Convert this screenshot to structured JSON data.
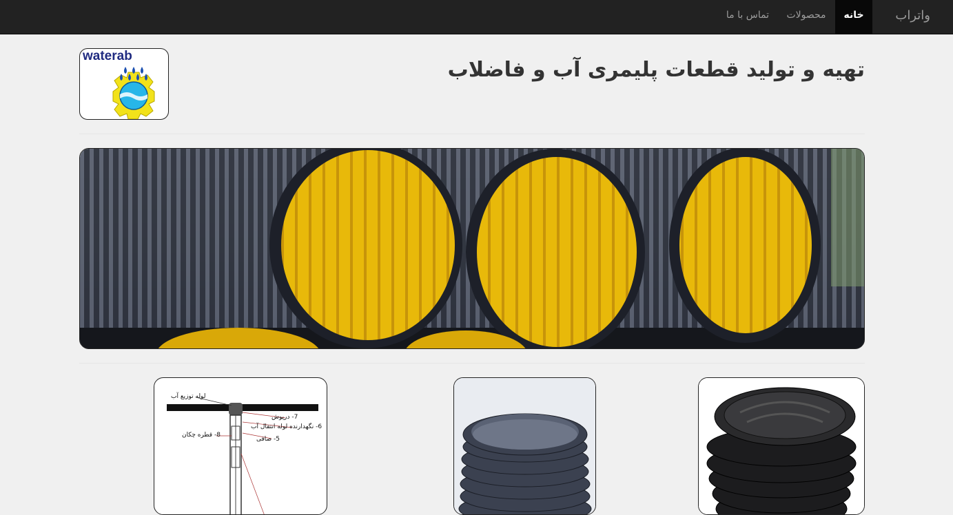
{
  "navbar": {
    "brand": "واتراب",
    "items": [
      {
        "label": "خانه",
        "active": true
      },
      {
        "label": "محصولات",
        "active": false
      },
      {
        "label": "تماس با ما",
        "active": false
      }
    ]
  },
  "header": {
    "title": "تهیه و تولید قطعات پلیمری آب و فاضلاب",
    "logo_text": "waterab"
  },
  "banner": {
    "image": "corrugated-pipes-photo"
  },
  "products": [
    {
      "image": "pipe-fitting-diagram",
      "labels": [
        "لوله توزیع آب",
        "7- درپوش",
        "6- نگهدارنده لوله انتقال آب",
        "8- قطره چکان",
        "5- صافی"
      ]
    },
    {
      "image": "corrugated-pipe-section"
    },
    {
      "image": "manhole-cover-chamber"
    }
  ],
  "colors": {
    "navbar_bg": "#222222",
    "nav_active_bg": "#080808",
    "page_bg": "#f0f0f0",
    "pipe_inner_yellow": "#e6b800",
    "pipe_outer_dark": "#2b2f3a"
  }
}
